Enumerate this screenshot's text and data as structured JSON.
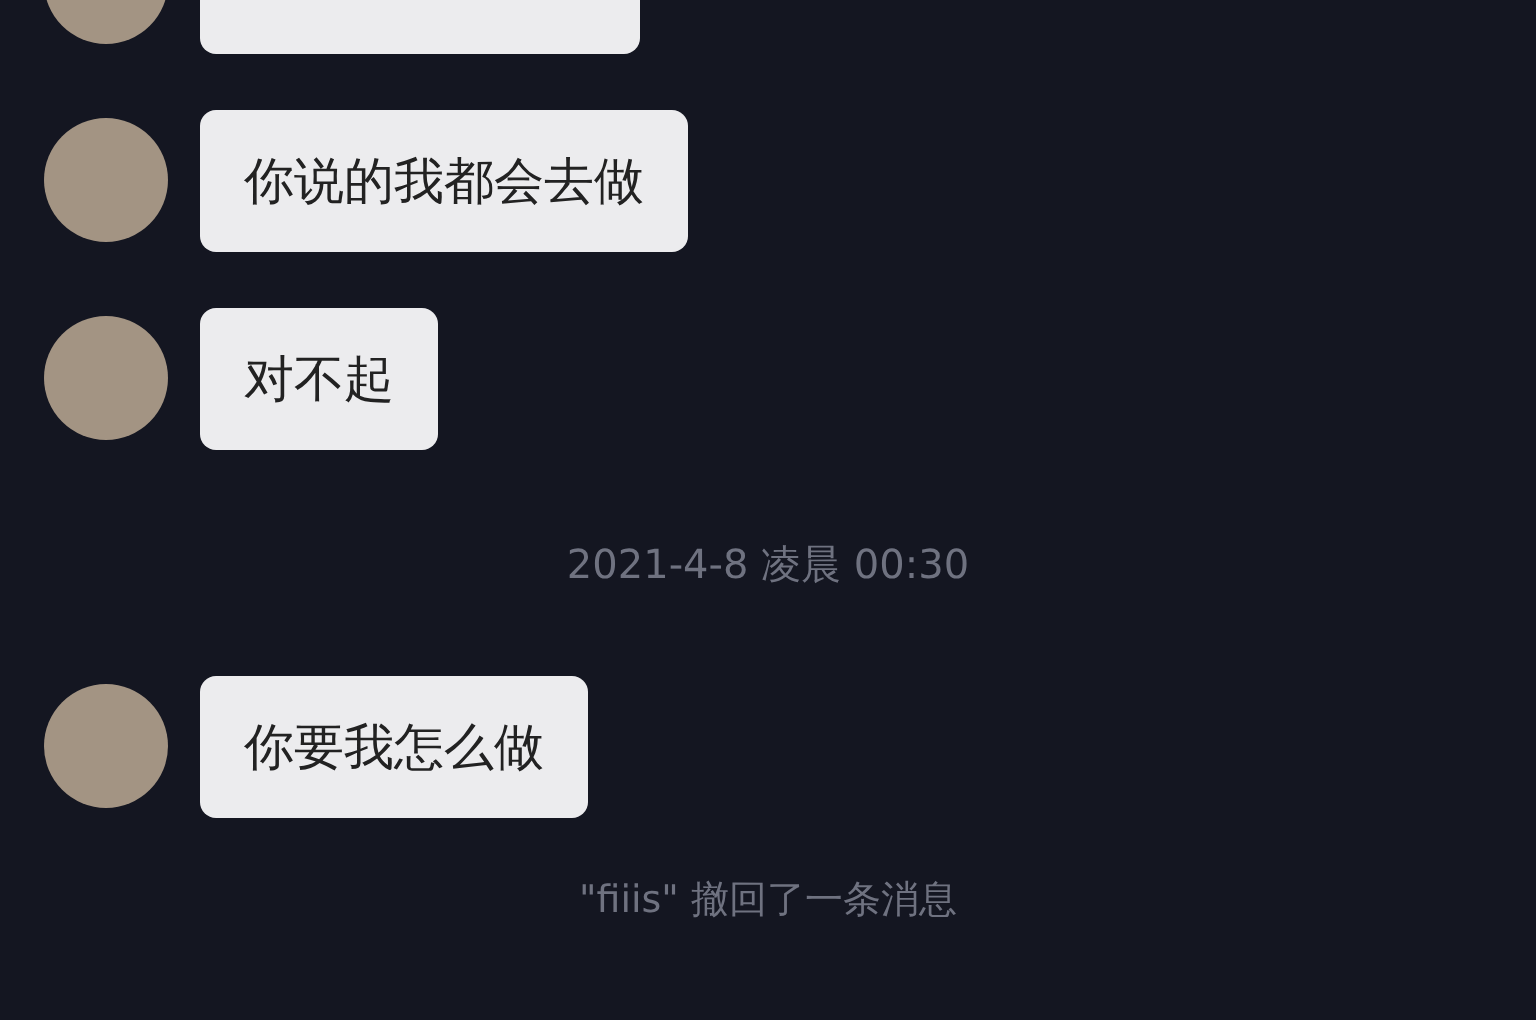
{
  "messages": [
    {
      "kind": "cut_message"
    },
    {
      "kind": "message",
      "text": "你说的我都会去做"
    },
    {
      "kind": "message",
      "text": "对不起"
    },
    {
      "kind": "time",
      "text": "2021-4-8 凌晨 00:30"
    },
    {
      "kind": "message",
      "text": "你要我怎么做"
    },
    {
      "kind": "recall",
      "text": "\"fiiis\" 撤回了一条消息"
    }
  ]
}
